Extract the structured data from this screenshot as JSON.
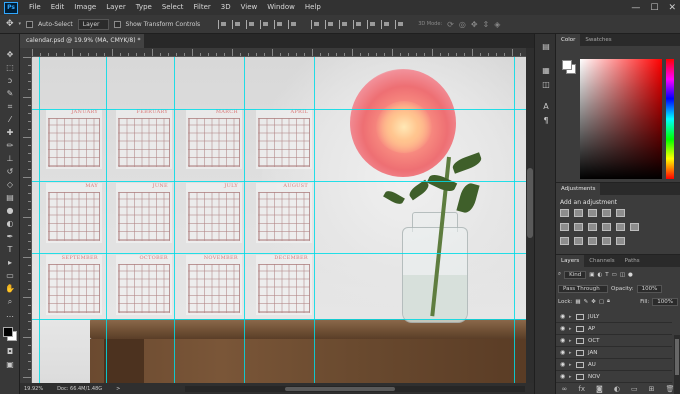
{
  "menubar": {
    "logo": "Ps",
    "items": [
      "File",
      "Edit",
      "Image",
      "Layer",
      "Type",
      "Select",
      "Filter",
      "3D",
      "View",
      "Window",
      "Help"
    ],
    "window_controls": [
      "—",
      "☐",
      "✕"
    ]
  },
  "options": {
    "auto_select_label": "Auto-Select",
    "auto_select_value": "Layer",
    "transform_label": "Show Transform Controls",
    "mode_3d_label": "3D Mode:"
  },
  "document": {
    "tab_title": "calendar.psd @ 19.9% (MA, CMYK/8) *",
    "close_glyph": "×"
  },
  "calendar": {
    "months": [
      "JANUARY",
      "FEBRUARY",
      "MARCH",
      "APRIL",
      "MAY",
      "JUNE",
      "JULY",
      "AUGUST",
      "SEPTEMBER",
      "OCTOBER",
      "NOVEMBER",
      "DECEMBER"
    ]
  },
  "status": {
    "zoom": "19.92%",
    "doc": "Doc: 66.4M/1.48G",
    "arrow": ">"
  },
  "color_panel": {
    "tabs": [
      "Color",
      "Swatches"
    ]
  },
  "adjustments_panel": {
    "tab": "Adjustments",
    "title": "Add an adjustment"
  },
  "layers_panel": {
    "tabs": [
      "Layers",
      "Channels",
      "Paths"
    ],
    "kind_label": "Kind",
    "blend_mode": "Pass Through",
    "opacity_label": "Opacity:",
    "opacity_value": "100%",
    "lock_label": "Lock:",
    "fill_label": "Fill:",
    "fill_value": "100%",
    "layers": [
      "JULY",
      "AP",
      "OCT",
      "JAN",
      "AU",
      "NOV"
    ]
  },
  "icons": {
    "tools": [
      "move-icon",
      "marquee-icon",
      "lasso-icon",
      "quick-select-icon",
      "crop-icon",
      "eyedropper-icon",
      "healing-icon",
      "brush-icon",
      "stamp-icon",
      "history-brush-icon",
      "eraser-icon",
      "gradient-icon",
      "blur-icon",
      "dodge-icon",
      "pen-icon",
      "type-icon",
      "path-select-icon",
      "shape-icon",
      "hand-icon",
      "zoom-icon"
    ]
  }
}
